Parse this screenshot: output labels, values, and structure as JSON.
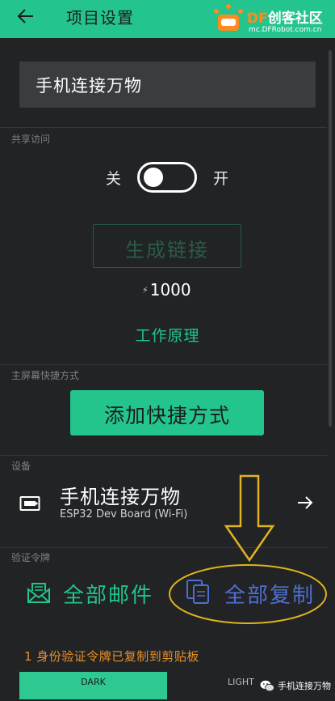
{
  "header": {
    "title": "项目设置",
    "back_icon": "arrow-left-icon",
    "bg_color": "#24c48e"
  },
  "logo": {
    "brand_df": "DF",
    "brand_cn": "创客社区",
    "url": "mc.DFRobot.com.cn"
  },
  "project": {
    "name": "手机连接万物"
  },
  "share": {
    "section_label": "共享访问",
    "toggle_off_label": "关",
    "toggle_on_label": "开",
    "toggle_state": "off",
    "generate_link_label": "生成链接",
    "energy_icon": "lightning-icon",
    "energy_cost": "1000",
    "how_it_works": "工作原理"
  },
  "home_screen": {
    "section_label": "主屏幕快捷方式",
    "add_shortcut_label": "添加快捷方式"
  },
  "device": {
    "section_label": "设备",
    "name": "手机连接万物",
    "model": "ESP32 Dev Board (Wi-Fi)",
    "icon": "board-icon",
    "arrow_icon": "arrow-right-icon"
  },
  "auth_token": {
    "section_label": "验证令牌",
    "email_all_label": "全部邮件",
    "copy_all_label": "全部复制",
    "copied_notice": "1 身份验证令牌已复制到剪贴板"
  },
  "theme": {
    "dark_label": "DARK",
    "light_label": "LIGHT"
  },
  "watermark": {
    "label": "手机连接万物"
  },
  "colors": {
    "accent": "#24c48e",
    "background": "#212325",
    "annotation": "#e0b21e",
    "copy_blue": "#4f6fd0",
    "notice_orange": "#e8902a"
  }
}
